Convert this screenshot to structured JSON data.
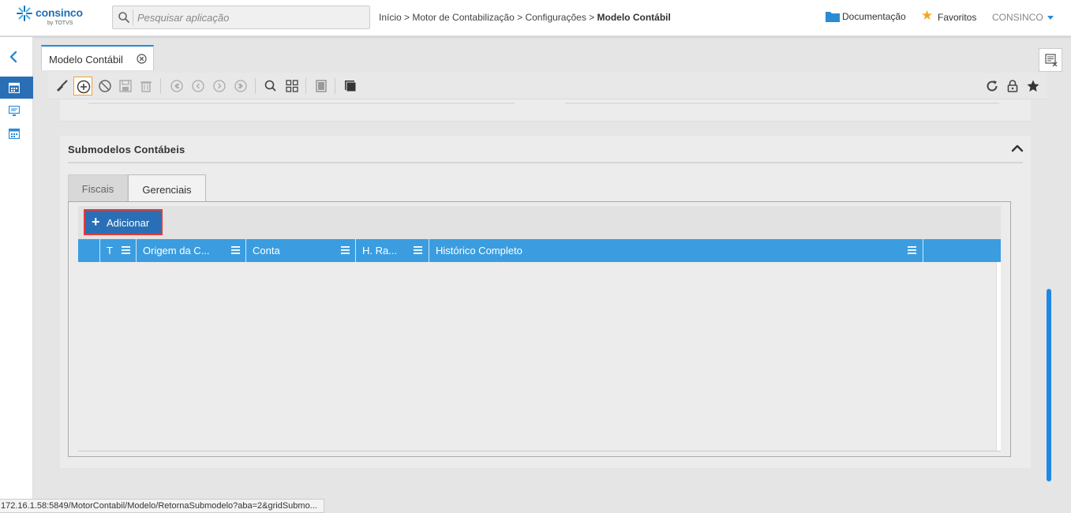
{
  "header": {
    "logo_text": "consinco",
    "logo_by": "by TOTVS",
    "search_placeholder": "Pesquisar aplicação",
    "breadcrumb": {
      "prefix": "Início > Motor de Contabilização > Configurações > ",
      "current": "Modelo Contábil"
    },
    "documentation_label": "Documentação",
    "favorites_label": "Favoritos",
    "user_label": "CONSINCO"
  },
  "tab": {
    "label": "Modelo Contábil"
  },
  "section": {
    "title": "Submodelos Contábeis",
    "tabs": [
      "Fiscais",
      "Gerenciais"
    ],
    "active_tab": "Gerenciais"
  },
  "grid": {
    "add_label": "Adicionar",
    "columns": [
      "T",
      "Origem da C...",
      "Conta",
      "H. Ra...",
      "Histórico Completo"
    ],
    "rows": []
  },
  "status_bar": {
    "url": "172.16.1.58:5849/MotorContabil/Modelo/RetornaSubmodelo?aba=2&gridSubmo..."
  },
  "colors": {
    "accent": "#2a8ad4",
    "grid_header": "#3b9ddf",
    "add_button": "#2a6fb5",
    "highlight_border": "#e53935",
    "star": "#f5a623"
  }
}
